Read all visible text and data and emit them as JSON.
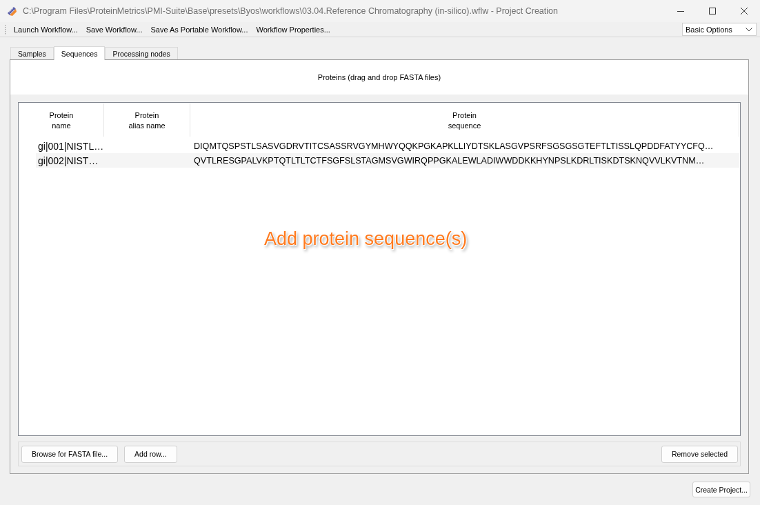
{
  "window": {
    "title": "C:\\Program Files\\ProteinMetrics\\PMI-Suite\\Base\\presets\\Byos\\workflows\\03.04.Reference Chromatography (in-silico).wflw - Project Creation"
  },
  "toolbar": {
    "actions": [
      "Launch Workflow...",
      "Save Workflow...",
      "Save As Portable Workflow...",
      "Workflow Properties..."
    ],
    "options_dropdown": {
      "value": "Basic Options"
    }
  },
  "tabs": [
    {
      "label": "Samples",
      "selected": false
    },
    {
      "label": "Sequences",
      "selected": true
    },
    {
      "label": "Processing nodes",
      "selected": false
    }
  ],
  "proteins_panel": {
    "heading": "Proteins (drag and drop FASTA files)",
    "table": {
      "columns": [
        "Protein\nname",
        "Protein\nalias name",
        "Protein\nsequence"
      ],
      "rows": [
        {
          "name": "gi|001|NISTL…",
          "sequence": "DIQMTQSPSTLSASVGDRVTITCSASSRVGYMHWYQQKPGKAPKLLIYDTSKLASGVPSRFSGSGSGTEFTLTISSLQPDDFATYYCFQ…"
        },
        {
          "name": "gi|002|NIST…",
          "sequence": "QVTLRESGPALVKPTQTLTLTCTFSGFSLSTAGMSVGWIRQPPGKALEWLADIWWDDKKHYNPSLKDRLTISKDTSKNQVVLKVTNM…"
        }
      ]
    },
    "annotation": "Add protein sequence(s)",
    "buttons_left": [
      "Browse for FASTA file...",
      "Add row..."
    ],
    "buttons_right": [
      "Remove selected"
    ]
  },
  "footer_buttons": [
    "Create Project..."
  ]
}
